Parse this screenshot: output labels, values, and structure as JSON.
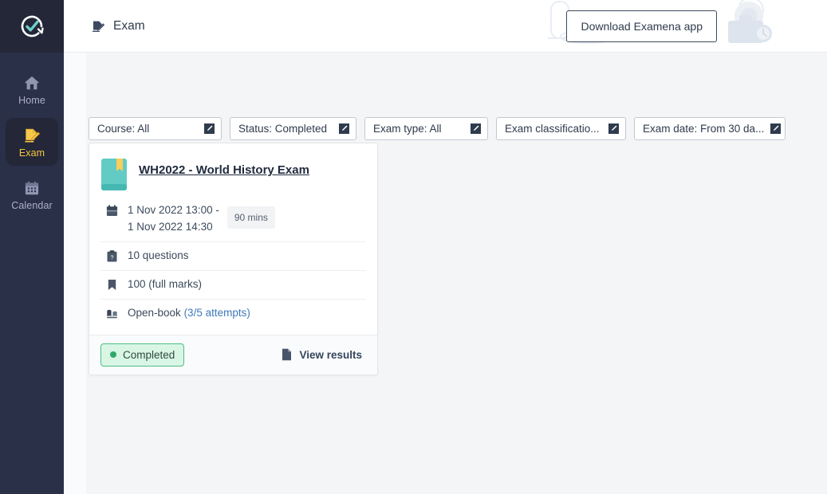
{
  "brand": {
    "logo_name": "checkmark-refresh-logo",
    "accent_teal": "#6ecfc8",
    "accent_yellow": "#f5c542",
    "sidebar_bg": "#2b3049"
  },
  "sidebar": {
    "items": [
      {
        "label": "Home",
        "icon": "home-icon",
        "active": false
      },
      {
        "label": "Exam",
        "icon": "exam-pencil-icon",
        "active": true
      },
      {
        "label": "Calendar",
        "icon": "calendar-icon",
        "active": false
      }
    ]
  },
  "topbar": {
    "page_icon": "exam-pencil-icon",
    "title": "Exam",
    "download_button": "Download Examena app",
    "decorations": [
      "test-tube-icon",
      "open-book-icon",
      "bell-icon",
      "briefcase-clock-icon"
    ]
  },
  "filters": [
    {
      "label": "Course: All",
      "icon": "edit-pencil-icon",
      "width_class": "fw-course"
    },
    {
      "label": "Status: Completed",
      "icon": "edit-pencil-icon",
      "width_class": "fw-status"
    },
    {
      "label": "Exam type: All",
      "icon": "edit-pencil-icon",
      "width_class": "fw-type"
    },
    {
      "label": "Exam classificatio...",
      "icon": "edit-pencil-icon",
      "width_class": "fw-class"
    },
    {
      "label": "Exam date: From 30 da...",
      "icon": "edit-pencil-icon",
      "width_class": "fw-date"
    }
  ],
  "exam_card": {
    "book_icon": "book-bookmark-icon",
    "title": "WH2022 - World History Exam",
    "datetime_icon": "calendar-icon",
    "datetime_line1": "1 Nov 2022 13:00 -",
    "datetime_line2": "1 Nov 2022 14:30",
    "duration": "90 mins",
    "questions_icon": "clipboard-question-icon",
    "questions": "10 questions",
    "marks_icon": "bookmark-icon",
    "marks": "100 (full marks)",
    "book_type_icon": "open-book-icon",
    "book_type": "Open-book",
    "attempts": "(3/5 attempts)",
    "status": "Completed",
    "status_color": "#2fa96b",
    "view_results_icon": "file-icon",
    "view_results": "View results"
  }
}
